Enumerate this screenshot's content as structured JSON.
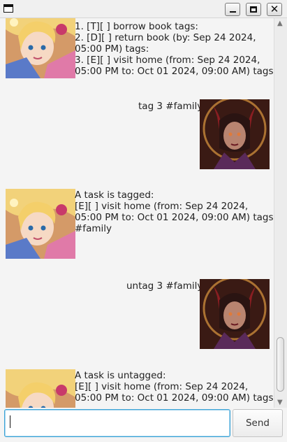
{
  "window": {
    "minimize_icon": "minimize-icon",
    "maximize_icon": "maximize-icon",
    "close_glyph": "✕"
  },
  "messages": [
    {
      "sender": "bot",
      "text": "1. [T][ ] borrow book tags:\n2. [D][ ] return book (by: Sep 24 2024,\n05:00 PM) tags:\n3. [E][ ] visit home (from: Sep 24 2024,\n05:00 PM to: Oct 01 2024, 09:00 AM) tags:"
    },
    {
      "sender": "user",
      "text": "tag 3 #family"
    },
    {
      "sender": "bot",
      "text": "A task is tagged:\n[E][ ] visit home (from: Sep 24 2024,\n05:00 PM to: Oct 01 2024, 09:00 AM) tags:\n#family"
    },
    {
      "sender": "user",
      "text": "untag 3 #family"
    },
    {
      "sender": "bot",
      "text": "A task is untagged:\n[E][ ] visit home (from: Sep 24 2024,\n05:00 PM to: Oct 01 2024, 09:00 AM) tags:"
    }
  ],
  "input": {
    "value": "",
    "placeholder": ""
  },
  "send_label": "Send",
  "colors": {
    "input_focus": "#3aa3d6",
    "background": "#f4f4f4"
  }
}
